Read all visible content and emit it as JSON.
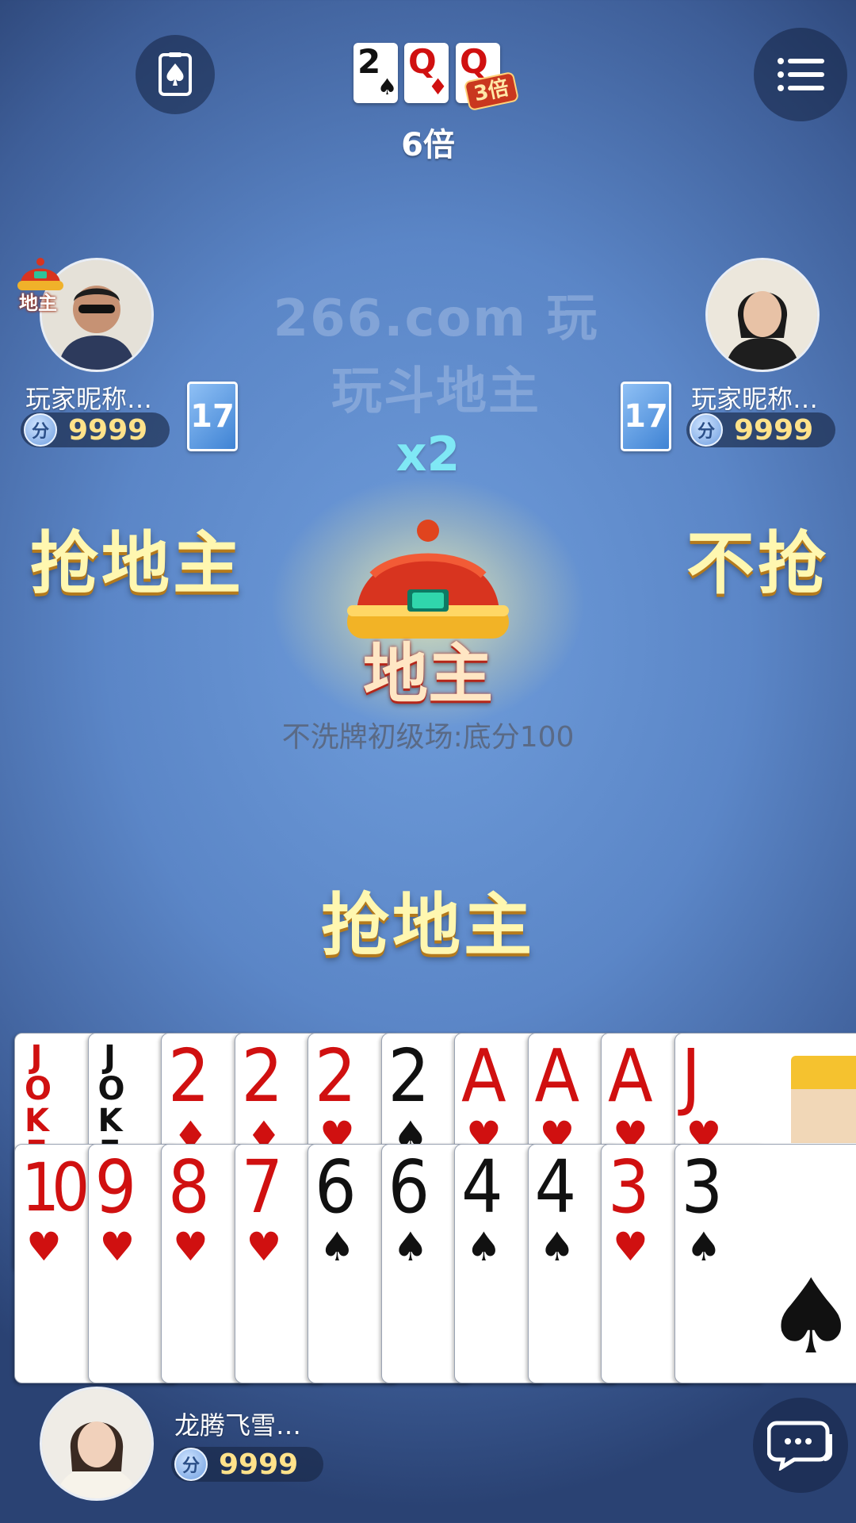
{
  "top": {
    "bottom_cards": [
      {
        "rank": "2",
        "suit": "♠",
        "color": "black"
      },
      {
        "rank": "Q",
        "suit": "♦",
        "color": "red"
      },
      {
        "rank": "Q",
        "suit": "",
        "color": "red"
      }
    ],
    "bottom_bonus_badge": "3倍",
    "total_multiplier": "6倍"
  },
  "watermark": "266.com 玩玩斗地主",
  "players": {
    "left": {
      "nickname": "玩家昵称…",
      "score": "9999",
      "card_count": "17",
      "role_badge": "地主",
      "action": "抢地主"
    },
    "right": {
      "nickname": "玩家昵称…",
      "score": "9999",
      "card_count": "17",
      "action": "不抢"
    }
  },
  "center": {
    "bid_multiplier": "x2",
    "landlord_label": "地主",
    "room_info": "不洗牌初级场:底分100",
    "my_action": "抢地主"
  },
  "self": {
    "nickname": "龙腾飞雪…",
    "score": "9999"
  },
  "score_icon_label": "分",
  "hand": {
    "back_row": [
      {
        "rank": "JOKER",
        "suit": "",
        "color": "red",
        "joker": true
      },
      {
        "rank": "JOKER",
        "suit": "",
        "color": "black",
        "joker": true
      },
      {
        "rank": "2",
        "suit": "♦",
        "color": "red"
      },
      {
        "rank": "2",
        "suit": "♦",
        "color": "red"
      },
      {
        "rank": "2",
        "suit": "♥",
        "color": "red"
      },
      {
        "rank": "2",
        "suit": "♠",
        "color": "black"
      },
      {
        "rank": "A",
        "suit": "♥",
        "color": "red"
      },
      {
        "rank": "A",
        "suit": "♥",
        "color": "red"
      },
      {
        "rank": "A",
        "suit": "♥",
        "color": "red"
      },
      {
        "rank": "J",
        "suit": "♥",
        "color": "red"
      }
    ],
    "front_row": [
      {
        "rank": "10",
        "suit": "♥",
        "color": "red"
      },
      {
        "rank": "9",
        "suit": "♥",
        "color": "red"
      },
      {
        "rank": "8",
        "suit": "♥",
        "color": "red"
      },
      {
        "rank": "7",
        "suit": "♥",
        "color": "red"
      },
      {
        "rank": "6",
        "suit": "♠",
        "color": "black"
      },
      {
        "rank": "6",
        "suit": "♠",
        "color": "black"
      },
      {
        "rank": "4",
        "suit": "♠",
        "color": "black"
      },
      {
        "rank": "4",
        "suit": "♠",
        "color": "black"
      },
      {
        "rank": "3",
        "suit": "♥",
        "color": "red"
      },
      {
        "rank": "3",
        "suit": "♠",
        "color": "black"
      }
    ]
  },
  "icons": {
    "card_counter": "spade-card-icon",
    "menu": "menu-icon",
    "chat": "chat-bubble-icon"
  }
}
